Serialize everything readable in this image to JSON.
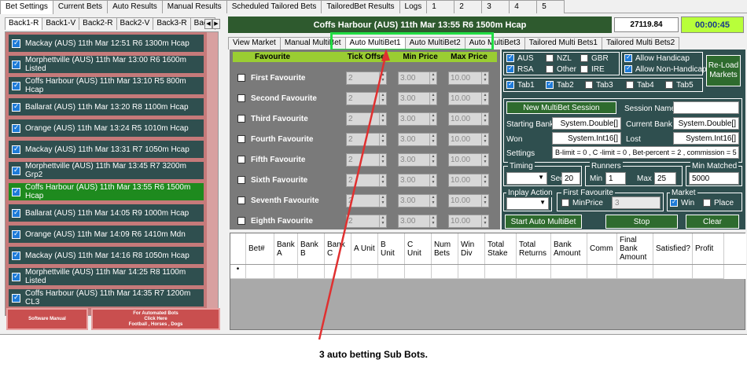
{
  "top_tabs": [
    "Bet Settings",
    "Current Bets",
    "Auto Results",
    "Manual Results",
    "Scheduled Tailored Bets",
    "TailoredBet Results",
    "Logs",
    "1",
    "2",
    "3",
    "4",
    "5"
  ],
  "back_tabs": [
    "Back1-R",
    "Back1-V",
    "Back2-R",
    "Back2-V",
    "Back3-R",
    "Back"
  ],
  "races": [
    "Mackay (AUS) 11th Mar 12:51 R6 1300m Hcap",
    "Morphettville (AUS) 11th Mar 13:00 R6 1600m Listed",
    "Coffs Harbour (AUS) 11th Mar 13:10 R5 800m Hcap",
    "Ballarat (AUS) 11th Mar 13:20 R8 1100m Hcap",
    "Orange (AUS) 11th Mar 13:24 R5 1010m Hcap",
    "Mackay (AUS) 11th Mar 13:31 R7 1050m Hcap",
    "Morphettville (AUS) 11th Mar 13:45 R7 3200m Grp2",
    "Coffs Harbour (AUS) 11th Mar 13:55 R6 1500m Hcap",
    "Ballarat (AUS) 11th Mar 14:05 R9 1000m Hcap",
    "Orange (AUS) 11th Mar 14:09 R6 1410m Mdn",
    "Mackay (AUS) 11th Mar 14:16 R8 1050m Hcap",
    "Morphettville (AUS) 11th Mar 14:25 R8 1100m Listed",
    "Coffs Harbour (AUS) 11th Mar 14:35 R7 1200m CL3"
  ],
  "left_buttons": {
    "manual": "Software Manual",
    "automated_line1": "For Automated Bots",
    "automated_line2": "Click Here",
    "automated_line3": "Football , Horses , Dogs"
  },
  "header": {
    "title": "Coffs Harbour (AUS) 11th Mar 13:55 R6 1500m Hcap",
    "balance": "27119.84",
    "timer": "00:00:45"
  },
  "sub_tabs": [
    "View Market",
    "Manual MultiBet",
    "Auto MultiBet1",
    "Auto MultiBet2",
    "Auto MultiBet3",
    "Tailored Multi Bets1",
    "Tailored Multi Bets2"
  ],
  "fav_header": {
    "favourite": "Favourite",
    "tick_offset": "Tick Offset",
    "min_price": "Min Price",
    "max_price": "Max Price"
  },
  "favourites": [
    {
      "label": "First Favourite",
      "tick": "2",
      "min": "3.00",
      "max": "10.00"
    },
    {
      "label": "Second Favourite",
      "tick": "2",
      "min": "3.00",
      "max": "10.00"
    },
    {
      "label": "Third Favourite",
      "tick": "2",
      "min": "3.00",
      "max": "10.00"
    },
    {
      "label": "Fourth Favourite",
      "tick": "2",
      "min": "3.00",
      "max": "10.00"
    },
    {
      "label": "Fifth Favourite",
      "tick": "2",
      "min": "3.00",
      "max": "10.00"
    },
    {
      "label": "Sixth Favourite",
      "tick": "2",
      "min": "3.00",
      "max": "10.00"
    },
    {
      "label": "Seventh Favourite",
      "tick": "2",
      "min": "3.00",
      "max": "10.00"
    },
    {
      "label": "Eighth Favourite",
      "tick": "2",
      "min": "3.00",
      "max": "10.00"
    }
  ],
  "countries": {
    "aus": "AUS",
    "nzl": "NZL",
    "gbr": "GBR",
    "rsa": "RSA",
    "other": "Other",
    "ire": "IRE"
  },
  "handicap": {
    "allow": "Allow Handicap",
    "non": "Allow Non-Handicap"
  },
  "reload": {
    "line1": "Re-Load",
    "line2": "Markets"
  },
  "tab_checks": [
    "Tab1",
    "Tab2",
    "Tab3",
    "Tab4",
    "Tab5"
  ],
  "session": {
    "new_button": "New MultiBet Session",
    "name_label": "Session Name",
    "starting_bank_label": "Starting Bank",
    "starting_bank": "System.Double[]",
    "current_bank_label": "Current Bank",
    "current_bank": "System.Double[]",
    "won_label": "Won",
    "won": "System.Int16[]",
    "lost_label": "Lost",
    "lost": "System.Int16[]",
    "settings_label": "Settings",
    "settings": "B-limit = 0 , C -limit = 0 , Bet-percent = 2 , commission = 5"
  },
  "timing": {
    "label": "Timing",
    "sec_label": "Sec",
    "sec": "20"
  },
  "runners": {
    "label": "Runners",
    "min_label": "Min",
    "min": "1",
    "max_label": "Max",
    "max": "25"
  },
  "min_matched": {
    "label": "Min Matched",
    "value": "5000"
  },
  "inplay": {
    "label": "Inplay Action"
  },
  "first_fav": {
    "label": "First Favourite",
    "minprice_label": "MinPrice",
    "minprice": "3"
  },
  "market": {
    "label": "Market",
    "win": "Win",
    "place": "Place"
  },
  "buttons": {
    "start": "Start Auto MultiBet",
    "stop": "Stop",
    "clear": "Clear"
  },
  "grid_columns": [
    "Bet#",
    "Bank A",
    "Bank B",
    "Bank C",
    "A Unit",
    "B Unit",
    "C Unit",
    "Num Bets",
    "Win Div",
    "Total Stake",
    "Total Returns",
    "Bank Amount",
    "Comm",
    "Final Bank Amount",
    "Satisfied?",
    "Profit"
  ],
  "grid_new_row_marker": "•",
  "caption": "3 auto betting Sub Bots."
}
